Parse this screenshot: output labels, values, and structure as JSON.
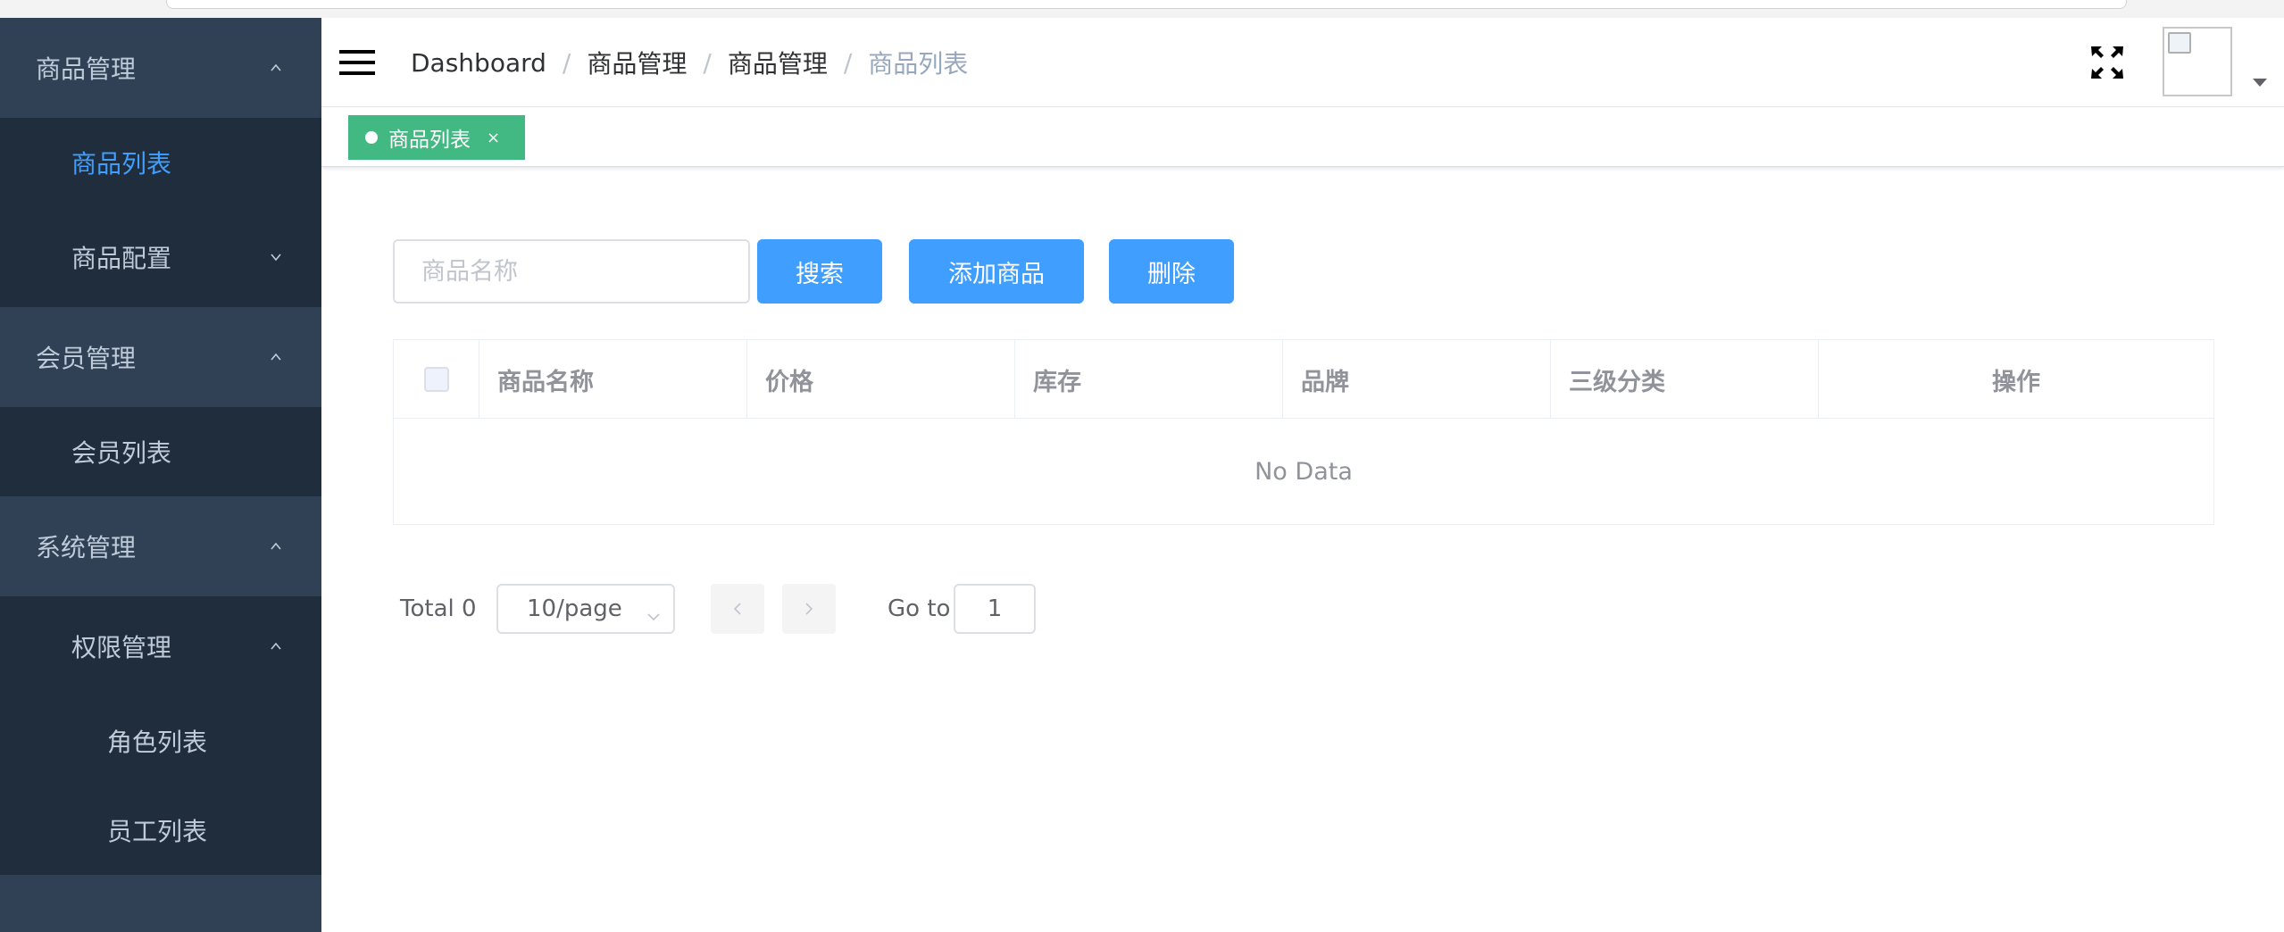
{
  "sidebar": {
    "groups": [
      {
        "label": "商品管理",
        "icon": "chevron-up-icon"
      },
      {
        "label": "会员管理",
        "icon": "chevron-up-icon"
      },
      {
        "label": "系统管理",
        "icon": "chevron-up-icon"
      }
    ],
    "items": {
      "product_list": "商品列表",
      "product_config": "商品配置",
      "member_list": "会员列表",
      "permission_mgmt": "权限管理",
      "role_list": "角色列表",
      "staff_list": "员工列表"
    },
    "active_color": "#409eff",
    "bg_color": "#304156"
  },
  "header": {
    "breadcrumb": [
      "Dashboard",
      "商品管理",
      "商品管理",
      "商品列表"
    ],
    "separator": "/"
  },
  "tags": {
    "active": {
      "label": "商品列表",
      "close": "×",
      "color": "#42b983"
    }
  },
  "filter": {
    "search_placeholder": "商品名称",
    "search_value": "",
    "search_button": "搜索",
    "add_button": "添加商品",
    "delete_button": "删除"
  },
  "table": {
    "columns": [
      "商品名称",
      "价格",
      "库存",
      "品牌",
      "三级分类",
      "操作"
    ],
    "empty_text": "No Data"
  },
  "pagination": {
    "total": "Total 0",
    "page_size": "10/page",
    "goto_label": "Go to",
    "current_page": "1"
  }
}
